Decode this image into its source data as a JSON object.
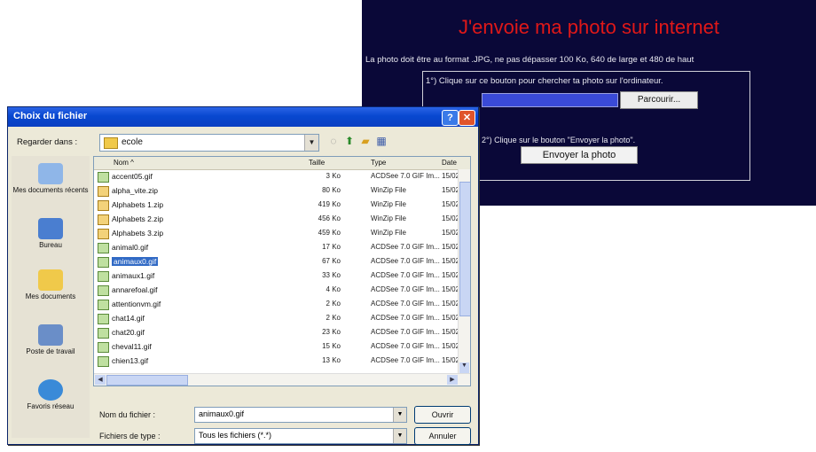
{
  "webpage": {
    "title": "J'envoie ma photo sur internet",
    "notice": "La photo doit être au format .JPG, ne pas dépasser 100 Ko, 640 de large et 480 de haut",
    "step1": "1°) Clique sur ce bouton pour chercher ta photo sur l'ordinateur.",
    "browse_label": "Parcourir...",
    "step2": "2°) Clique sur le bouton \"Envoyer la photo\".",
    "send_label": "Envoyer la photo"
  },
  "dialog": {
    "title": "Choix du fichier",
    "help": "?",
    "close": "✕",
    "lookin_label": "Regarder dans :",
    "lookin_value": "ecole",
    "places": [
      "Mes documents récents",
      "Bureau",
      "Mes documents",
      "Poste de travail",
      "Favoris réseau"
    ],
    "columns": {
      "name": "Nom",
      "size": "Taille",
      "type": "Type",
      "date": "Date"
    },
    "files": [
      {
        "name": "accent05.gif",
        "size": "3 Ko",
        "type": "ACDSee 7.0 GIF Im...",
        "date": "15/02",
        "kind": "gif"
      },
      {
        "name": "alpha_vite.zip",
        "size": "80 Ko",
        "type": "WinZip File",
        "date": "15/02",
        "kind": "zip"
      },
      {
        "name": "Alphabets 1.zip",
        "size": "419 Ko",
        "type": "WinZip File",
        "date": "15/02",
        "kind": "zip"
      },
      {
        "name": "Alphabets 2.zip",
        "size": "456 Ko",
        "type": "WinZip File",
        "date": "15/02",
        "kind": "zip"
      },
      {
        "name": "Alphabets 3.zip",
        "size": "459 Ko",
        "type": "WinZip File",
        "date": "15/02",
        "kind": "zip"
      },
      {
        "name": "animal0.gif",
        "size": "17 Ko",
        "type": "ACDSee 7.0 GIF Im...",
        "date": "15/02",
        "kind": "gif"
      },
      {
        "name": "animaux0.gif",
        "size": "67 Ko",
        "type": "ACDSee 7.0 GIF Im...",
        "date": "15/02",
        "kind": "gif",
        "selected": true
      },
      {
        "name": "animaux1.gif",
        "size": "33 Ko",
        "type": "ACDSee 7.0 GIF Im...",
        "date": "15/02",
        "kind": "gif"
      },
      {
        "name": "annarefoal.gif",
        "size": "4 Ko",
        "type": "ACDSee 7.0 GIF Im...",
        "date": "15/02",
        "kind": "gif"
      },
      {
        "name": "attentionvm.gif",
        "size": "2 Ko",
        "type": "ACDSee 7.0 GIF Im...",
        "date": "15/02",
        "kind": "gif"
      },
      {
        "name": "chat14.gif",
        "size": "2 Ko",
        "type": "ACDSee 7.0 GIF Im...",
        "date": "15/02",
        "kind": "gif"
      },
      {
        "name": "chat20.gif",
        "size": "23 Ko",
        "type": "ACDSee 7.0 GIF Im...",
        "date": "15/02",
        "kind": "gif"
      },
      {
        "name": "cheval11.gif",
        "size": "15 Ko",
        "type": "ACDSee 7.0 GIF Im...",
        "date": "15/02",
        "kind": "gif"
      },
      {
        "name": "chien13.gif",
        "size": "13 Ko",
        "type": "ACDSee 7.0 GIF Im...",
        "date": "15/02",
        "kind": "gif"
      }
    ],
    "filename_label": "Nom du fichier :",
    "filename_value": "animaux0.gif",
    "filetype_label": "Fichiers de type :",
    "filetype_value": "Tous les fichiers (*.*)",
    "open_label": "Ouvrir",
    "cancel_label": "Annuler"
  }
}
